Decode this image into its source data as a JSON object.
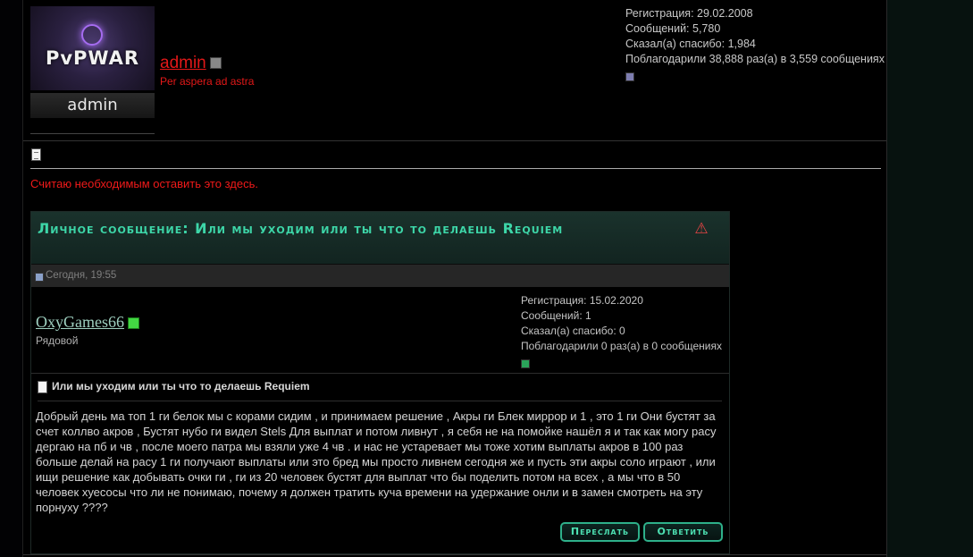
{
  "poster": {
    "avatar_logo": "PvPWAR",
    "avatar_name": "admin",
    "name": "admin",
    "title": "Per aspera ad astra",
    "stats": [
      "Регистрация: 29.02.2008",
      "Сообщений: 5,780",
      "Сказал(а) спасибо: 1,984",
      "Поблагодарили 38,888 раз(а) в 3,559 сообщениях"
    ]
  },
  "post": {
    "text": "Считаю необходимым оставить это здесь."
  },
  "pm": {
    "title": "Личное сообщение: Или мы уходим или ты что то делаешь Requiem",
    "date": "Сегодня, 19:55",
    "user": {
      "name": "OxyGames66",
      "rank": "Рядовой",
      "stats": [
        "Регистрация: 15.02.2020",
        "Сообщений: 1",
        "Сказал(а) спасибо: 0",
        "Поблагодарили 0 раз(а) в 0 сообщениях"
      ]
    },
    "subject": "Или мы уходим или ты что то делаешь Requiem",
    "body": "Добрый день ма топ 1 ги белок мы с корами сидим , и принимаем решение , Акры ги Блек миррор и 1 , это 1 ги Они бустят за счет коллво акров , Бустят нубо ги видел Stels Для выплат и потом ливнут , я себя не на помойке нашёл я и так как могу расу дергаю на пб и чв , после моего патра мы взяли уже 4 чв . и нас не устаревает мы тоже хотим выплаты акров в 100 раз больше делай на расу 1 ги получают выплаты или это бред мы просто ливнем сегодня же и пусть эти акры соло играют , или ищи решение как добывать очки ги , ги из 20 человек бустят для выплат что бы поделить потом на всех , а мы что в 50 человек хуесосы что ли не понимаю, почему я должен тратить куча времени на удержание онли и в замен смотреть на эту порнуху ????",
    "buttons": {
      "forward": "Переслать",
      "reply": "Ответить"
    }
  },
  "colors": {
    "accent": "#3dd6a8",
    "admin_red": "#e21818",
    "background": "#000000"
  }
}
